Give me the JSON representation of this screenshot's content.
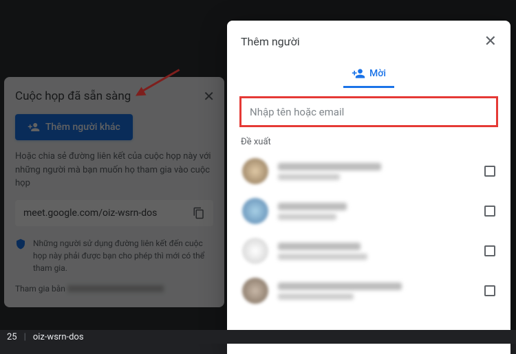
{
  "bgPanel": {
    "title": "Cuộc họp đã sẵn sàng",
    "addButton": "Thêm người khác",
    "description": "Hoặc chia sẻ đường liên kết của cuộc họp này với những người mà bạn muốn họ tham gia vào cuộc họp",
    "meetingLink": "meet.google.com/oiz-wsrn-dos",
    "shieldNote": "Những người sử dụng đường liên kết đến cuộc họp này phải được bạn cho phép thì mới có thể tham gia.",
    "joinAs": "Tham gia bằn"
  },
  "dialog": {
    "title": "Thêm người",
    "tabInvite": "Mời",
    "searchPlaceholder": "Nhập tên hoặc email",
    "suggestLabel": "Đề xuất"
  },
  "bottomBar": {
    "time": "25",
    "code": "oiz-wsrn-dos"
  }
}
